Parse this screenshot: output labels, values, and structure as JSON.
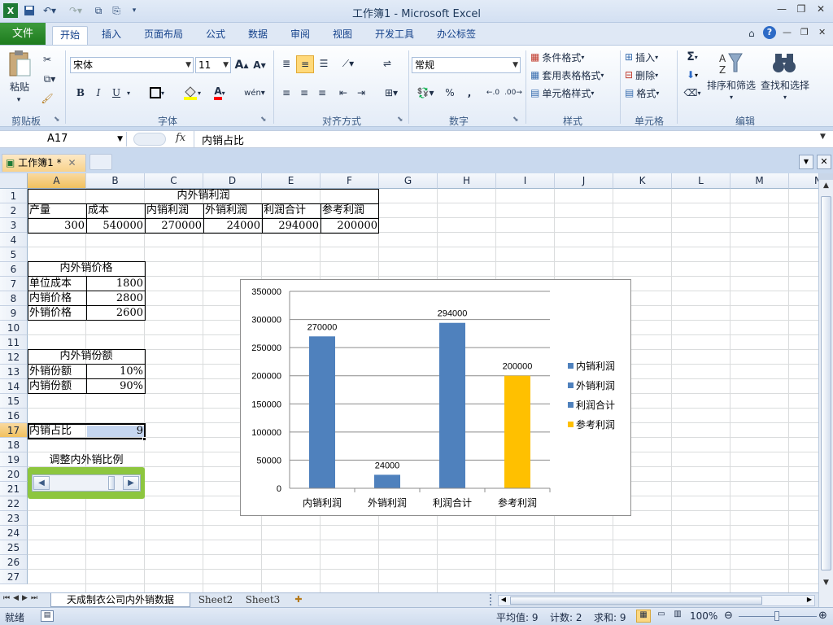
{
  "window": {
    "title": "工作簿1 - Microsoft Excel"
  },
  "tabs": {
    "file": "文件",
    "home": "开始",
    "insert": "插入",
    "page_layout": "页面布局",
    "formulas": "公式",
    "data": "数据",
    "review": "审阅",
    "view": "视图",
    "developer": "开发工具",
    "office_tab": "办公标签"
  },
  "ribbon": {
    "clipboard": {
      "paste": "粘贴",
      "label": "剪贴板"
    },
    "font": {
      "name": "宋体",
      "size": "11",
      "label": "字体",
      "bold": "B",
      "italic": "I",
      "underline": "U",
      "font_color_glyph": "A",
      "increase_glyph": "A",
      "decrease_glyph": "A"
    },
    "alignment": {
      "label": "对齐方式"
    },
    "number": {
      "format": "常规",
      "label": "数字",
      "percent": "%",
      "comma": ","
    },
    "styles": {
      "conditional": "条件格式",
      "table": "套用表格格式",
      "cell": "单元格样式",
      "label": "样式"
    },
    "cells": {
      "insert": "插入",
      "delete": "删除",
      "format": "格式",
      "label": "单元格"
    },
    "editing": {
      "sort": "排序和筛选",
      "find": "查找和选择",
      "label": "编辑",
      "sigma": "Σ"
    }
  },
  "formula_bar": {
    "name_box": "A17",
    "fx": "fx",
    "content": "内销占比"
  },
  "workbook_tab": {
    "name": "工作簿1 *"
  },
  "columns": [
    "A",
    "B",
    "C",
    "D",
    "E",
    "F",
    "G",
    "H",
    "I",
    "J",
    "K",
    "L",
    "M",
    "N"
  ],
  "rows": [
    "1",
    "2",
    "3",
    "4",
    "5",
    "6",
    "7",
    "8",
    "9",
    "10",
    "11",
    "12",
    "13",
    "14",
    "15",
    "16",
    "17",
    "18",
    "19",
    "20",
    "21",
    "22",
    "23",
    "24",
    "25",
    "26",
    "27"
  ],
  "sheet": {
    "t1": {
      "title": "内外销利润",
      "h1": "产量",
      "h2": "成本",
      "h3": "内销利润",
      "h4": "外销利润",
      "h5": "利润合计",
      "h6": "参考利润",
      "v1": "300",
      "v2": "540000",
      "v3": "270000",
      "v4": "24000",
      "v5": "294000",
      "v6": "200000"
    },
    "t2": {
      "title": "内外销价格",
      "l1": "单位成本",
      "v1": "1800",
      "l2": "内销价格",
      "v2": "2800",
      "l3": "外销价格",
      "v3": "2600"
    },
    "t3": {
      "title": "内外销份额",
      "l1": "外销份额",
      "v1": "10%",
      "l2": "内销份额",
      "v2": "90%"
    },
    "a17": "内销占比",
    "b17": "9",
    "scroll_label": "调整内外销比例"
  },
  "chart_data": {
    "type": "bar",
    "categories": [
      "内销利润",
      "外销利润",
      "利润合计",
      "参考利润"
    ],
    "values": [
      270000,
      24000,
      294000,
      200000
    ],
    "data_labels": [
      "270000",
      "24000",
      "294000",
      "200000"
    ],
    "colors": [
      "#4f81bd",
      "#4f81bd",
      "#4f81bd",
      "#ffc000"
    ],
    "ylim": [
      0,
      350000
    ],
    "yticks": [
      "0",
      "50000",
      "100000",
      "150000",
      "200000",
      "250000",
      "300000",
      "350000"
    ],
    "grid": true,
    "legend_position": "right",
    "legend": [
      {
        "name": "内销利润",
        "color": "#4f81bd"
      },
      {
        "name": "外销利润",
        "color": "#4f81bd"
      },
      {
        "name": "利润合计",
        "color": "#4f81bd"
      },
      {
        "name": "参考利润",
        "color": "#ffc000"
      }
    ]
  },
  "sheet_tabs": [
    "天成制衣公司内外销数据",
    "Sheet2",
    "Sheet3"
  ],
  "status": {
    "ready": "就绪",
    "average": "平均值: 9",
    "count": "计数: 2",
    "sum": "求和: 9",
    "zoom": "100%"
  }
}
